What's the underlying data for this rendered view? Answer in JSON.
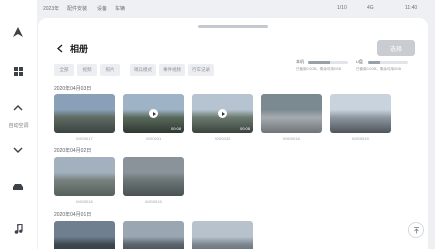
{
  "status_bar": {
    "left_texts": [
      "2023年",
      "配件安装",
      "设备",
      "车辆"
    ],
    "right_texts": [
      "1/10",
      "4G",
      "11:40"
    ]
  },
  "sidebar": {
    "items": [
      {
        "icon": "navigation-arrow-icon"
      },
      {
        "icon": "app-grid-icon"
      },
      {
        "icon": "fan-up-icon",
        "caption": "自动空调"
      },
      {
        "icon": "fan-down-icon"
      },
      {
        "icon": "car-icon"
      },
      {
        "icon": "music-note-icon"
      }
    ]
  },
  "header": {
    "title": "相册",
    "action_label": "选择"
  },
  "filters": [
    "全部",
    "视频",
    "照片",
    "哨兵模式",
    "事件视频",
    "行车记录"
  ],
  "storage": [
    {
      "label": "本机",
      "fill": 0.55,
      "detail": "已使用0.0GB，剩余可用0GB"
    },
    {
      "label": "U盘",
      "fill": 0.3,
      "detail": "已使用0.0GB，剩余可用0GB"
    }
  ],
  "groups": [
    {
      "date": "2020年04月03日",
      "items": [
        {
          "type": "photo",
          "caption": "IMG0017",
          "colors": [
            "#8aa0b8",
            "#5e6b62",
            "#3b4340"
          ]
        },
        {
          "type": "video",
          "caption": "VID0031",
          "duration": "00:08",
          "colors": [
            "#9fb3c7",
            "#596a5b",
            "#2f3732"
          ]
        },
        {
          "type": "video",
          "caption": "VID0032",
          "duration": "00:08",
          "colors": [
            "#b6c4d2",
            "#6b7a6e",
            "#3a423d"
          ]
        },
        {
          "type": "photo",
          "caption": "IMG0018",
          "colors": [
            "#7a8a90",
            "#a6abb0",
            "#6e7478"
          ]
        },
        {
          "type": "photo",
          "caption": "IMG0019",
          "colors": [
            "#c9d3dd",
            "#8d98a2",
            "#4f5458"
          ]
        }
      ]
    },
    {
      "date": "2020年04月02日",
      "items": [
        {
          "type": "photo",
          "caption": "IMG0016",
          "colors": [
            "#a3b1bf",
            "#77807e",
            "#56605c"
          ]
        },
        {
          "type": "photo",
          "caption": "IMG0015",
          "colors": [
            "#8a929a",
            "#6b7576",
            "#4b5253"
          ]
        }
      ]
    },
    {
      "date": "2020年04月01日",
      "items": [
        {
          "type": "photo",
          "caption": "",
          "colors": [
            "#6f7f8f",
            "#3d4850",
            "#2a3036"
          ]
        },
        {
          "type": "photo",
          "caption": "",
          "colors": [
            "#9aa6b2",
            "#5a646c",
            "#383e43"
          ]
        },
        {
          "type": "photo",
          "caption": "",
          "colors": [
            "#b8c2cc",
            "#7d8790",
            "#4c5358"
          ]
        }
      ]
    }
  ]
}
